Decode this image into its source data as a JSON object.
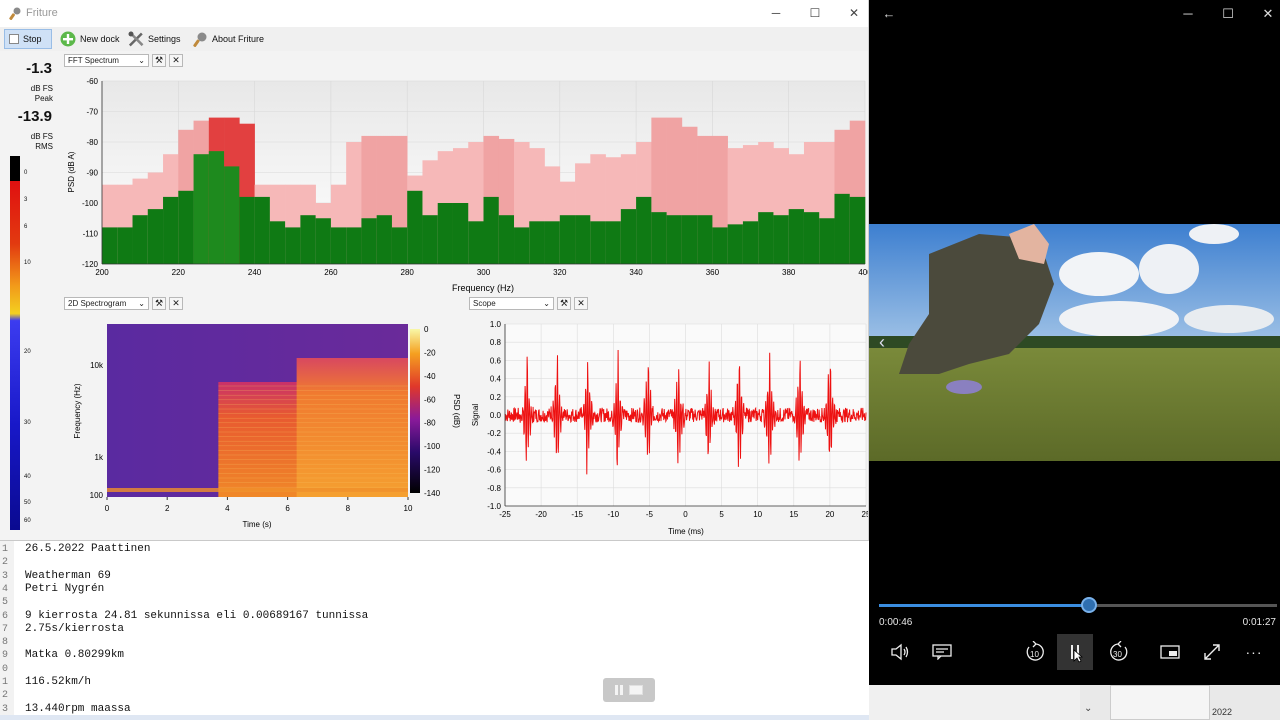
{
  "friture": {
    "title": "Friture",
    "toolbar": [
      {
        "label": "Stop"
      },
      {
        "label": "New dock"
      },
      {
        "label": "Settings"
      },
      {
        "label": "About Friture"
      }
    ],
    "levels": {
      "peak_value": "-1.3",
      "peak_unit": "dB FS",
      "peak_label": "Peak",
      "rms_value": "-13.9",
      "rms_unit": "dB FS",
      "rms_label": "RMS",
      "meter_ticks": [
        "0",
        "3",
        "6",
        "10",
        "20",
        "30",
        "40",
        "50",
        "60"
      ]
    },
    "docks": {
      "fft": "FFT Spectrum",
      "spectrogram": "2D Spectrogram",
      "scope": "Scope"
    }
  },
  "chart_data": [
    {
      "type": "bar",
      "chart": "FFT Spectrum",
      "xlabel": "Frequency (Hz)",
      "ylabel": "PSD (dB A)",
      "xlim": [
        200,
        400
      ],
      "ylim": [
        -120,
        -60
      ],
      "x_ticks": [
        200,
        220,
        240,
        260,
        280,
        300,
        320,
        340,
        360,
        380,
        400
      ],
      "y_ticks": [
        -60,
        -70,
        -80,
        -90,
        -100,
        -110,
        -120
      ],
      "x": [
        200,
        204,
        208,
        212,
        216,
        220,
        224,
        228,
        232,
        236,
        240,
        244,
        248,
        252,
        256,
        260,
        264,
        268,
        272,
        276,
        280,
        284,
        288,
        292,
        296,
        300,
        304,
        308,
        312,
        316,
        320,
        324,
        328,
        332,
        336,
        340,
        344,
        348,
        352,
        356,
        360,
        364,
        368,
        372,
        376,
        380,
        384,
        388,
        392,
        396
      ],
      "series": [
        {
          "name": "Peak hold",
          "values": [
            -94,
            -94,
            -92,
            -90,
            -84,
            -76,
            -73,
            -72,
            -72,
            -74,
            -94,
            -94,
            -94,
            -94,
            -100,
            -94,
            -80,
            -78,
            -78,
            -78,
            -91,
            -86,
            -83,
            -82,
            -80,
            -78,
            -79,
            -80,
            -82,
            -88,
            -93,
            -87,
            -84,
            -85,
            -84,
            -80,
            -72,
            -72,
            -75,
            -78,
            -78,
            -82,
            -81,
            -80,
            -82,
            -84,
            -80,
            -80,
            -76,
            -73
          ]
        },
        {
          "name": "PSD",
          "values": [
            -108,
            -108,
            -104,
            -102,
            -98,
            -96,
            -84,
            -83,
            -88,
            -98,
            -98,
            -106,
            -108,
            -104,
            -105,
            -108,
            -108,
            -105,
            -104,
            -108,
            -96,
            -104,
            -100,
            -100,
            -106,
            -98,
            -104,
            -108,
            -106,
            -106,
            -104,
            -104,
            -106,
            -106,
            -102,
            -98,
            -103,
            -104,
            -104,
            -104,
            -108,
            -107,
            -106,
            -103,
            -104,
            -102,
            -103,
            -105,
            -97,
            -98
          ]
        }
      ]
    },
    {
      "type": "heatmap",
      "chart": "2D Spectrogram",
      "xlabel": "Time (s)",
      "ylabel": "Frequency (Hz)",
      "colorbar_label": "PSD (dB)",
      "xlim": [
        0,
        10
      ],
      "x_ticks": [
        0,
        2,
        4,
        6,
        8,
        10
      ],
      "y_ticks": [
        "100",
        "1k",
        "10k"
      ],
      "colorbar_ticks": [
        0,
        -20,
        -40,
        -60,
        -80,
        -100,
        -120,
        -140
      ],
      "events_s": [
        3.7,
        6.3
      ]
    },
    {
      "type": "line",
      "chart": "Scope",
      "xlabel": "Time (ms)",
      "ylabel": "Signal",
      "xlim": [
        -25,
        25
      ],
      "ylim": [
        -1.0,
        1.0
      ],
      "x_ticks": [
        -25,
        -20,
        -15,
        -10,
        -5,
        0,
        5,
        10,
        15,
        20,
        25
      ],
      "y_ticks": [
        1.0,
        0.8,
        0.6,
        0.4,
        0.2,
        0.0,
        -0.2,
        -0.4,
        -0.6,
        -0.8,
        -1.0
      ],
      "pulses_ms": [
        -22,
        -17.8,
        -13.6,
        -9.4,
        -5.2,
        -1,
        3.2,
        7.4,
        11.6,
        15.8,
        20
      ],
      "pulse_peak": 0.85,
      "pulse_trough": -0.95
    }
  ],
  "editor": {
    "lines": [
      {
        "n": "1",
        "text": "26.5.2022 Paattinen"
      },
      {
        "n": "2",
        "text": ""
      },
      {
        "n": "3",
        "text": "Weatherman 69"
      },
      {
        "n": "4",
        "text": "Petri Nygrén"
      },
      {
        "n": "5",
        "text": ""
      },
      {
        "n": "6",
        "text": "9 kierrosta 24.81 sekunnissa eli 0.00689167 tunnissa"
      },
      {
        "n": "7",
        "text": "2.75s/kierrosta"
      },
      {
        "n": "8",
        "text": ""
      },
      {
        "n": "9",
        "text": "Matka 0.80299km"
      },
      {
        "n": "0",
        "text": ""
      },
      {
        "n": "1",
        "text": "116.52km/h"
      },
      {
        "n": "2",
        "text": ""
      },
      {
        "n": "3",
        "text": "13.440rpm maassa"
      }
    ]
  },
  "player": {
    "current_time": "0:00:46",
    "total_time": "0:01:27",
    "progress": 0.5287,
    "skip_back": "10",
    "skip_forward": "30"
  },
  "taskbar": {
    "date_fragment": "2022"
  }
}
